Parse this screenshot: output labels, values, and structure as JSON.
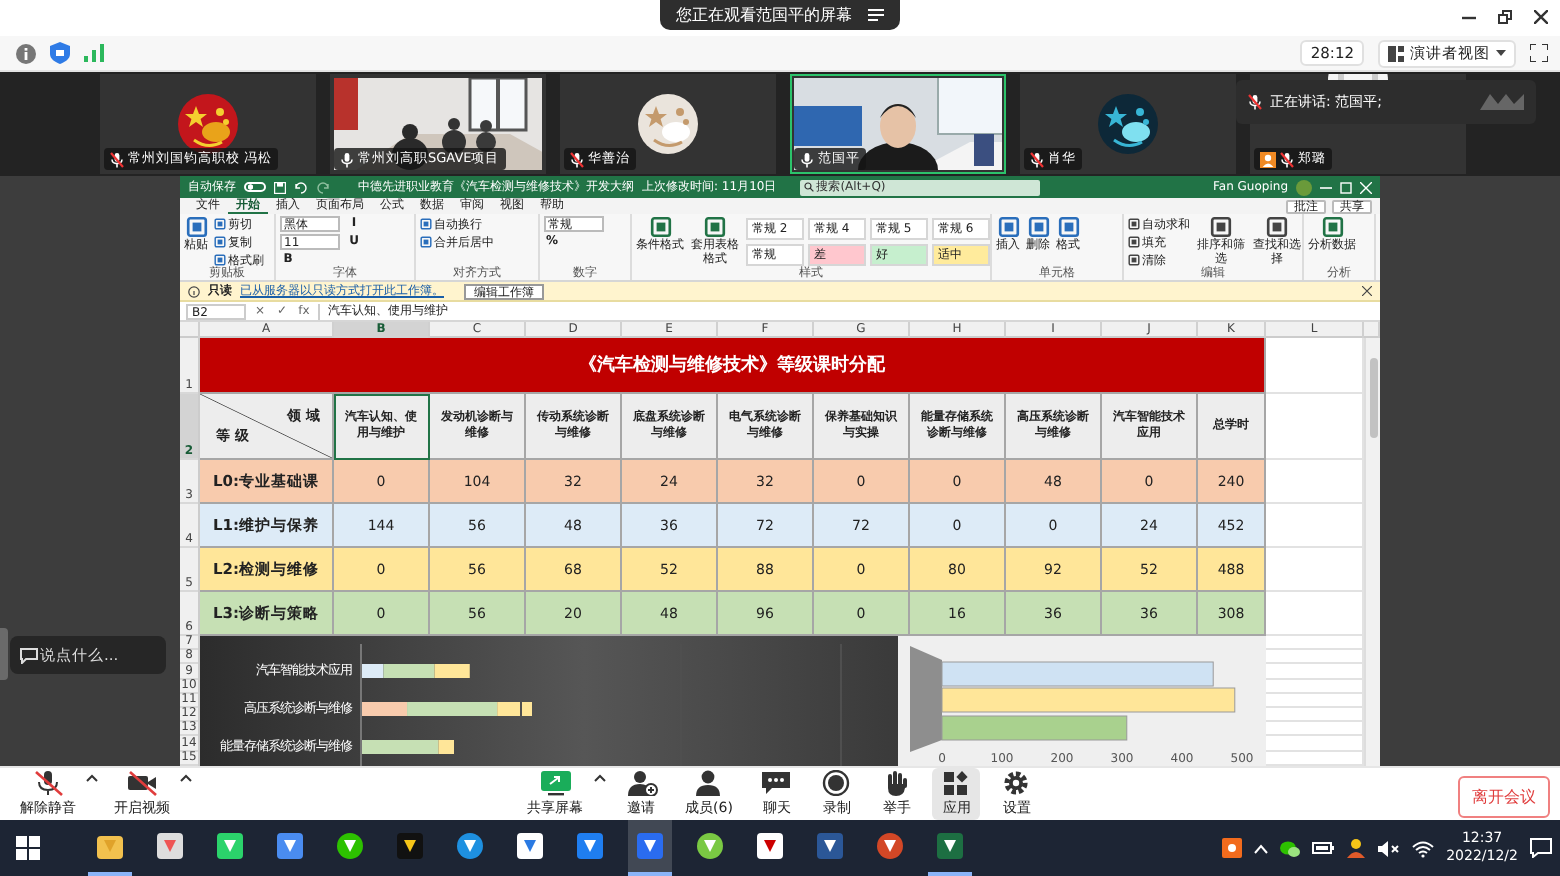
{
  "banner": {
    "text": "您正在观看范国平的屏幕"
  },
  "meeting_bar": {
    "timer": "28:12",
    "view_button": "演讲者视图"
  },
  "participants": [
    {
      "name": "常州刘国钧高职校 冯松",
      "kind": "avatar",
      "muted": true,
      "speaking": false
    },
    {
      "name": "常州刘高职SGAVE项目",
      "kind": "video",
      "muted": false,
      "speaking": false
    },
    {
      "name": "华善治",
      "kind": "avatar",
      "muted": true,
      "speaking": false
    },
    {
      "name": "范国平",
      "kind": "video",
      "muted": false,
      "speaking": true
    },
    {
      "name": "肖华",
      "kind": "avatar",
      "muted": true,
      "speaking": false
    },
    {
      "name": "郑璐",
      "kind": "profile",
      "muted": true,
      "speaking": false
    }
  ],
  "speaking_notice": "正在讲话: 范国平;",
  "chat_input": {
    "placeholder": "说点什么..."
  },
  "excel": {
    "autosave": {
      "label": "自动保存",
      "on": false
    },
    "title": "中德先进职业教育《汽车检测与维修技术》开发大纲",
    "saved": "上次修改时间: 11月10日",
    "search": {
      "placeholder": "搜索(Alt+Q)"
    },
    "user": "Fan Guoping",
    "tabs": [
      {
        "label": "文件",
        "selected": false
      },
      {
        "label": "开始",
        "selected": true
      },
      {
        "label": "插入",
        "selected": false
      },
      {
        "label": "页面布局",
        "selected": false
      },
      {
        "label": "公式",
        "selected": false
      },
      {
        "label": "数据",
        "selected": false
      },
      {
        "label": "审阅",
        "selected": false
      },
      {
        "label": "视图",
        "selected": false
      },
      {
        "label": "帮助",
        "selected": false
      }
    ],
    "tab_buttons": [
      "批注",
      "共享"
    ],
    "ribbon": [
      {
        "label": "剪贴板",
        "items": [
          {
            "kind": "large",
            "label": "粘贴"
          },
          {
            "kind": "small",
            "label": "剪切"
          },
          {
            "kind": "small",
            "label": "复制"
          },
          {
            "kind": "small",
            "label": "格式刷"
          }
        ]
      },
      {
        "label": "字体",
        "items": [
          {
            "kind": "field",
            "label": "黑体"
          },
          {
            "kind": "field",
            "label": "11"
          },
          {
            "kind": "glyph",
            "label": "B"
          },
          {
            "kind": "glyph",
            "label": "I"
          },
          {
            "kind": "glyph",
            "label": "U"
          }
        ]
      },
      {
        "label": "对齐方式",
        "items": [
          {
            "kind": "small",
            "label": "自动换行"
          },
          {
            "kind": "small",
            "label": "合并后居中"
          }
        ]
      },
      {
        "label": "数字",
        "items": [
          {
            "kind": "field",
            "label": "常规"
          },
          {
            "kind": "glyph",
            "label": "%"
          }
        ]
      },
      {
        "label": "样式",
        "items": [
          {
            "kind": "large",
            "label": "条件格式"
          },
          {
            "kind": "large",
            "label": "套用表格格式"
          },
          {
            "kind": "style",
            "label": "常规 2",
            "color": "#ffffff"
          },
          {
            "kind": "style",
            "label": "常规 4",
            "color": "#ffffff"
          },
          {
            "kind": "style",
            "label": "常规 5",
            "color": "#ffffff"
          },
          {
            "kind": "style",
            "label": "常规 6",
            "color": "#ffffff"
          },
          {
            "kind": "style",
            "label": "常规",
            "color": "#ffffff"
          },
          {
            "kind": "style",
            "label": "差",
            "color": "#ffc7ce"
          },
          {
            "kind": "style",
            "label": "好",
            "color": "#c6efce"
          },
          {
            "kind": "style",
            "label": "适中",
            "color": "#ffeb9c"
          }
        ]
      },
      {
        "label": "单元格",
        "items": [
          {
            "kind": "large",
            "label": "插入"
          },
          {
            "kind": "large",
            "label": "删除"
          },
          {
            "kind": "large",
            "label": "格式"
          }
        ]
      },
      {
        "label": "编辑",
        "items": [
          {
            "kind": "small",
            "label": "自动求和"
          },
          {
            "kind": "small",
            "label": "填充"
          },
          {
            "kind": "small",
            "label": "清除"
          },
          {
            "kind": "large",
            "label": "排序和筛选"
          },
          {
            "kind": "large",
            "label": "查找和选择"
          }
        ]
      },
      {
        "label": "分析",
        "items": [
          {
            "kind": "large",
            "label": "分析数据"
          }
        ]
      }
    ],
    "message": {
      "label": "只读",
      "link": "已从服务器以只读方式打开此工作簿。",
      "button": "编辑工作簿"
    },
    "formula_bar": {
      "name_box": "B2",
      "buttons": [
        "×",
        "✓",
        "fx"
      ],
      "value": "汽车认知、使用与维护"
    },
    "columns": [
      {
        "label": "A",
        "selected": false
      },
      {
        "label": "B",
        "selected": true
      },
      {
        "label": "C",
        "selected": false
      },
      {
        "label": "D",
        "selected": false
      },
      {
        "label": "E",
        "selected": false
      },
      {
        "label": "F",
        "selected": false
      },
      {
        "label": "G",
        "selected": false
      },
      {
        "label": "H",
        "selected": false
      },
      {
        "label": "I",
        "selected": false
      },
      {
        "label": "J",
        "selected": false
      },
      {
        "label": "K",
        "selected": false
      },
      {
        "label": "L",
        "selected": false
      }
    ],
    "row_numbers": [
      {
        "label": "1",
        "selected": false
      },
      {
        "label": "2",
        "selected": true
      },
      {
        "label": "3",
        "selected": false
      },
      {
        "label": "4",
        "selected": false
      },
      {
        "label": "5",
        "selected": false
      },
      {
        "label": "6",
        "selected": false
      },
      {
        "label": "7",
        "selected": false
      },
      {
        "label": "8",
        "selected": false
      },
      {
        "label": "9",
        "selected": false
      },
      {
        "label": "10",
        "selected": false
      },
      {
        "label": "11",
        "selected": false
      },
      {
        "label": "12",
        "selected": false
      },
      {
        "label": "13",
        "selected": false
      },
      {
        "label": "14",
        "selected": false
      },
      {
        "label": "15",
        "selected": false
      }
    ],
    "sheet": {
      "title": "《汽车检测与维修技术》等级课时分配",
      "corner_top": "领 域",
      "corner_bottom": "等 级",
      "headers": [
        {
          "text": "汽车认知、使用与维护",
          "selected": true
        },
        {
          "text": "发动机诊断与维修",
          "selected": false
        },
        {
          "text": "传动系统诊断与维修",
          "selected": false
        },
        {
          "text": "底盘系统诊断与维修",
          "selected": false
        },
        {
          "text": "电气系统诊断与维修",
          "selected": false
        },
        {
          "text": "保养基础知识与实操",
          "selected": false
        },
        {
          "text": "能量存储系统诊断与维修",
          "selected": false
        },
        {
          "text": "高压系统诊断与维修",
          "selected": false
        },
        {
          "text": "汽车智能技术应用",
          "selected": false
        },
        {
          "text": "总学时",
          "selected": false
        }
      ],
      "rows": [
        {
          "label": "L0:专业基础课",
          "color": "#f8cbad",
          "cells": [
            "0",
            "104",
            "32",
            "24",
            "32",
            "0",
            "0",
            "48",
            "0",
            "240"
          ]
        },
        {
          "label": "L1:维护与保养",
          "color": "#ddebf7",
          "cells": [
            "144",
            "56",
            "48",
            "36",
            "72",
            "72",
            "0",
            "0",
            "24",
            "452"
          ]
        },
        {
          "label": "L2:检测与维修",
          "color": "#ffe699",
          "cells": [
            "0",
            "56",
            "68",
            "52",
            "88",
            "0",
            "80",
            "92",
            "52",
            "488"
          ]
        },
        {
          "label": "L3:诊断与策略",
          "color": "#c6e0b4",
          "cells": [
            "0",
            "56",
            "20",
            "48",
            "96",
            "0",
            "16",
            "36",
            "36",
            "308"
          ]
        }
      ]
    },
    "chart_1": {
      "categories": [
        "汽车智能技术应用",
        "高压系统诊断与维修",
        "能量存储系统诊断与维修"
      ]
    },
    "chart_2": {
      "chart_data": {
        "type": "bar",
        "orientation": "horizontal",
        "categories": [
          null,
          null,
          null
        ],
        "xlim": [
          0,
          500
        ],
        "xticks": [
          0,
          100,
          200,
          300,
          400,
          500
        ],
        "values": [
          452,
          488,
          308
        ],
        "colors": [
          "#cfe2f3",
          "#ffe699",
          "#a9d18e"
        ]
      }
    }
  },
  "toolbar": {
    "left": [
      {
        "label": "解除静音",
        "on": false,
        "has_menu": true
      },
      {
        "label": "开启视频",
        "on": false,
        "has_menu": true
      }
    ],
    "center": [
      {
        "label": "共享屏幕",
        "selected": false,
        "has_menu": true
      },
      {
        "label": "邀请",
        "selected": false,
        "has_menu": false
      },
      {
        "label": "成员(6)",
        "selected": false,
        "has_menu": false
      },
      {
        "label": "聊天",
        "selected": false,
        "has_menu": false
      },
      {
        "label": "录制",
        "selected": false,
        "has_menu": false
      },
      {
        "label": "举手",
        "selected": false,
        "has_menu": false
      },
      {
        "label": "应用",
        "selected": true,
        "has_menu": false
      },
      {
        "label": "设置",
        "selected": false,
        "has_menu": false
      }
    ],
    "leave": "离开会议"
  },
  "taskbar": {
    "apps": [
      {
        "running": true,
        "selected": false
      },
      {
        "running": false,
        "selected": false
      },
      {
        "running": false,
        "selected": false
      },
      {
        "running": false,
        "selected": false
      },
      {
        "running": false,
        "selected": false
      },
      {
        "running": false,
        "selected": false
      },
      {
        "running": false,
        "selected": false
      },
      {
        "running": false,
        "selected": false
      },
      {
        "running": false,
        "selected": false
      },
      {
        "running": true,
        "selected": true
      },
      {
        "running": false,
        "selected": false
      },
      {
        "running": false,
        "selected": false
      },
      {
        "running": false,
        "selected": false
      },
      {
        "running": false,
        "selected": false
      },
      {
        "running": true,
        "selected": false
      }
    ],
    "time": "12:37",
    "date": "2022/12/2"
  }
}
